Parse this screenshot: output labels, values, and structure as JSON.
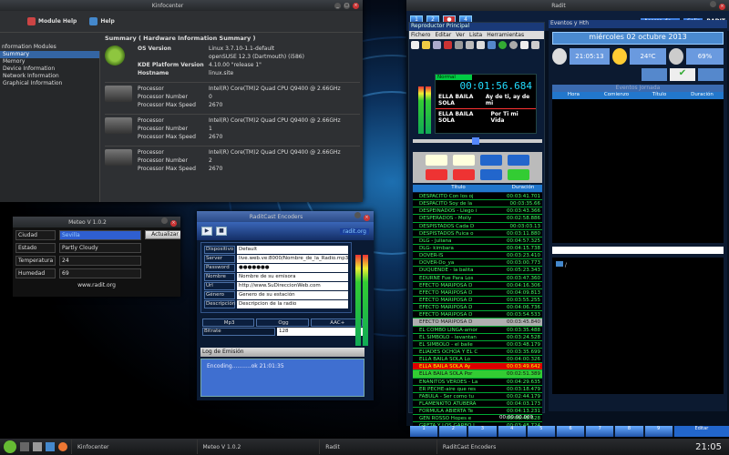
{
  "kinfo": {
    "title": "Kinfocenter",
    "module_help": "Module Help",
    "help": "Help",
    "side_header": "nformation Modules",
    "side": [
      "Summary",
      "Memory",
      "Device Information",
      "Network Information",
      "Graphical Information"
    ],
    "summary_title": "Summary ( Hardware Information Summary )",
    "os": [
      [
        "OS Version",
        "Linux 3.7.10-1.1-default"
      ],
      [
        "",
        "openSUSE 12.3 (Dartmouth) (i586)"
      ],
      [
        "KDE Platform Version",
        "4.10.00 \"release 1\""
      ],
      [
        "Hostname",
        "linux.site"
      ]
    ],
    "cpus": [
      [
        "Intel(R) Core(TM)2 Quad CPU    Q9400  @ 2.66GHz",
        "0",
        "2670"
      ],
      [
        "Intel(R) Core(TM)2 Quad CPU    Q9400  @ 2.66GHz",
        "1",
        "2670"
      ],
      [
        "Intel(R) Core(TM)2 Quad CPU    Q9400  @ 2.66GHz",
        "2",
        "2670"
      ]
    ],
    "k_processor": "Processor",
    "k_number": "Processor Number",
    "k_speed": "Processor Max Speed"
  },
  "meteo": {
    "title": "Meteo V 1.0.2",
    "labels": [
      "Ciudad",
      "Estado",
      "Temperatura",
      "Humedad"
    ],
    "values": [
      "Sevilla",
      "Partly Cloudy",
      "24",
      "69"
    ],
    "button": "Actualizar",
    "url": "www.radit.org"
  },
  "cast": {
    "title": "RaditCast Encoders",
    "url": "radit.org",
    "fields": [
      [
        "Dispositivo",
        "Default"
      ],
      [
        "Server",
        "live.web.ve:8000/Nombre_de_la_Radio.mp3"
      ],
      [
        "Password",
        "●●●●●●●"
      ],
      [
        "Nombre",
        "Nombre de su emisora"
      ],
      [
        "Url",
        "http://www.SuDireccionWeb.com"
      ],
      [
        "Género",
        "Genero de su estación"
      ],
      [
        "Descripción",
        "Descripcion de la radio"
      ]
    ],
    "formats": [
      "Mp3",
      "Ogg",
      "AAC+"
    ],
    "bitrate_label": "Bitrate",
    "bitrate": "128",
    "log_title": "Log de Emisión",
    "log": "Encoding...........ok  21:01:35"
  },
  "radit": {
    "title": "Radit",
    "acerca": "Acerca de...",
    "salir": "Salir",
    "brand": "RADIT",
    "player_title": "Reproductor Principal",
    "menu": [
      "Fichero",
      "Editar",
      "Ver",
      "Lista",
      "Herramientas"
    ],
    "mode": "Normal",
    "time": "00:01:56.684",
    "now1": "ELLA BAILA SOLA",
    "now1b": "Ay de ti, ay de mi",
    "now2": "ELLA BAILA SOLA",
    "now2b": "Por Ti mi Vida",
    "pl_head": [
      "Título",
      "Duración"
    ],
    "playlist": [
      [
        "DESPACITO    Con los oj",
        "00:03:41.701"
      ],
      [
        "DESPACITO    Soy de la",
        "00:03:35.66"
      ],
      [
        "DESPEINADOS - Llego i",
        "00:03:43.366"
      ],
      [
        "DESPERADOS - Molly",
        "00:02:58.886"
      ],
      [
        "DESPISTADOS   Cada D",
        "00:03:03.13"
      ],
      [
        "DESPISTADOS   Fuica o",
        "00:03:11.880"
      ],
      [
        "DLG - Juliana",
        "00:04:57.325"
      ],
      [
        "DLG- kimbara",
        "00:04:15.738"
      ],
      [
        "DOVER-IS",
        "00:03:23.410"
      ],
      [
        "DOVER-Do_ya",
        "00:03:00.773"
      ],
      [
        "DUQUENDE - la balita",
        "00:05:23.343"
      ],
      [
        "EDURNE    Fue Para Los",
        "00:03:47.360"
      ],
      [
        "EFECTO MARIPOSA    D",
        "00:04:16.306"
      ],
      [
        "EFECTO MARIPOSA    D",
        "00:04:09.813"
      ],
      [
        "EFECTO MARIPOSA    D",
        "00:03:55.255"
      ],
      [
        "EFECTO MARIPOSA    D",
        "00:04:06.736"
      ],
      [
        "EFECTO MARIPOSA    D",
        "00:03:54.533"
      ],
      [
        "EFECTO MARIPOSA    D",
        "00:03:45.840"
      ],
      [
        "EL COMBO LINGA-amor",
        "00:03:35.488"
      ],
      [
        "EL SIMBOLO - levantan",
        "00:03:24.528"
      ],
      [
        "EL SIMBOLO - el baile",
        "00:03:48.179"
      ],
      [
        "ELIADES OCHOA Y EL C",
        "00:03:35.699"
      ],
      [
        "ELLA BAILA SOLA   Lo",
        "00:04:00.326"
      ],
      [
        "ELLA BAILA SOLA    Ay",
        "00:03:49.642"
      ],
      [
        "ELLA BAILA SOLA    Por",
        "00:02:51.389"
      ],
      [
        "ENANITOS VERDES - La",
        "00:04:29.635"
      ],
      [
        "ER PECHE-aire que res",
        "00:03:18.479"
      ],
      [
        "FABULA - Ser como tu",
        "00:02:44.179"
      ],
      [
        "FLAMENKITO ATUBERA",
        "00:04:03.173"
      ],
      [
        "FORMULA ABIERTA   Te",
        "00:04:13.231"
      ],
      [
        "GEN ROSSO    Hopes e",
        "00:06:48.528"
      ],
      [
        "GRETA Y LOS GARBO I",
        "00:03:48.724"
      ],
      [
        "GUARANA    En La Cas",
        "00:04:02.886"
      ]
    ],
    "pl_time": "00:00:00.000",
    "events_title": "Eventos y Hth",
    "date": "miércoles  02 octubre 2013",
    "clock": "21:05:13",
    "temp": "24ºC",
    "hum": "69%",
    "ev_head": "Eventos Jornada",
    "ev_cols": [
      "Hora",
      "Comienzo",
      "Título",
      "Duración"
    ],
    "tree": "/",
    "bottom": [
      "1",
      "2",
      "3",
      "4",
      "5",
      "6",
      "7",
      "8",
      "9"
    ],
    "editar": "Editar"
  },
  "taskbar": {
    "items": [
      "Kinfocenter",
      "Meteo V 1.0.2",
      "Radit",
      "RaditCast Encoders"
    ],
    "clock": "21:05"
  },
  "colors": {
    "accent": "#3465a4",
    "green": "#44ff66",
    "red": "#dd0000"
  }
}
